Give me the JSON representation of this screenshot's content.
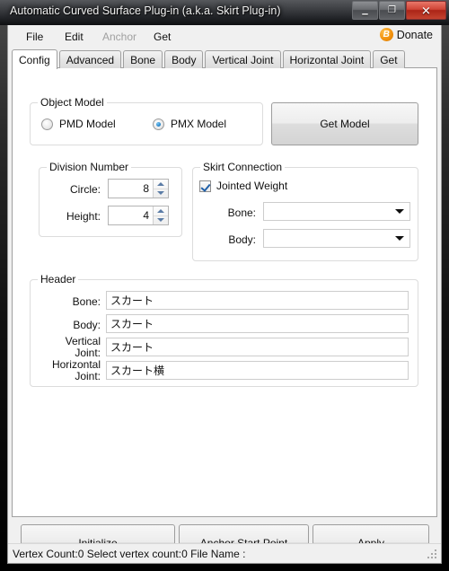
{
  "window": {
    "title": "Automatic Curved Surface Plug-in (a.k.a. Skirt Plug-in)",
    "minimize_label": "–",
    "maximize_label": "❐",
    "close_label": "✕",
    "minimize_icon": "minimize-icon",
    "maximize_icon": "maximize-icon",
    "close_icon": "close-icon"
  },
  "menu": {
    "items": [
      {
        "label": "File",
        "disabled": false
      },
      {
        "label": "Edit",
        "disabled": false
      },
      {
        "label": "Anchor",
        "disabled": true
      },
      {
        "label": "Get",
        "disabled": false
      }
    ],
    "donate_label": "Donate",
    "donate_icon_glyph": "B"
  },
  "tabs": [
    {
      "label": "Config",
      "active": true
    },
    {
      "label": "Advanced",
      "active": false
    },
    {
      "label": "Bone",
      "active": false
    },
    {
      "label": "Body",
      "active": false
    },
    {
      "label": "Vertical Joint",
      "active": false
    },
    {
      "label": "Horizontal Joint",
      "active": false
    },
    {
      "label": "Get",
      "active": false
    }
  ],
  "object_model": {
    "legend": "Object Model",
    "options": [
      {
        "label": "PMD Model",
        "selected": false
      },
      {
        "label": "PMX Model",
        "selected": true
      }
    ],
    "get_model_button": "Get Model"
  },
  "division_number": {
    "legend": "Division Number",
    "circle_label": "Circle:",
    "circle_value": "8",
    "height_label": "Height:",
    "height_value": "4"
  },
  "skirt_connection": {
    "legend": "Skirt Connection",
    "jointed_weight_label": "Jointed Weight",
    "jointed_weight_checked": true,
    "bone_label": "Bone:",
    "bone_value": "",
    "body_label": "Body:",
    "body_value": ""
  },
  "header": {
    "legend": "Header",
    "fields": [
      {
        "label": "Bone:",
        "value": "スカート"
      },
      {
        "label": "Body:",
        "value": "スカート"
      },
      {
        "label": "Vertical Joint:",
        "value": "スカート"
      },
      {
        "label": "Horizontal Joint:",
        "value": "スカート横"
      }
    ]
  },
  "actions": {
    "initialize": "Initialize",
    "anchor_start_point": "Anchor Start Point",
    "apply": "Apply"
  },
  "status": {
    "text": "Vertex Count:0  Select vertex count:0  File Name :"
  }
}
